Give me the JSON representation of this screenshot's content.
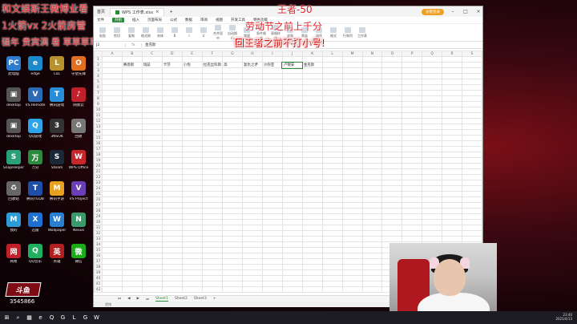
{
  "overlays": {
    "line1": "和文娱斯王微博业看",
    "line2": "1火箭vx 2火箭房管",
    "line3": "骚年 贵宾满 看 草草草草",
    "center_title": "王者-50",
    "center_line1": "劳动节之前上千分",
    "center_line2": "回王者之前不打小号!"
  },
  "desktop": {
    "icons": [
      {
        "label": "此电脑",
        "glyph": "PC",
        "color": "#2e7bcf"
      },
      {
        "label": "edge",
        "glyph": "e",
        "color": "#1a8acb"
      },
      {
        "label": "LoL",
        "glyph": "L",
        "color": "#b8922e"
      },
      {
        "label": "守望先锋",
        "glyph": "O",
        "color": "#e07020"
      },
      {
        "label": "desktop",
        "glyph": "▣",
        "color": "#555"
      },
      {
        "label": "VS Remote",
        "glyph": "V",
        "color": "#2c6ab3"
      },
      {
        "label": "腾讯游戏",
        "glyph": "T",
        "color": "#2a8dd8"
      },
      {
        "label": "网易云",
        "glyph": "♪",
        "color": "#c0202a"
      },
      {
        "label": "desktop",
        "glyph": "▣",
        "color": "#555"
      },
      {
        "label": "QQ游戏",
        "glyph": "Q",
        "color": "#2ea4e8"
      },
      {
        "label": "3NSOK",
        "glyph": "3",
        "color": "#333"
      },
      {
        "label": "回收",
        "glyph": "♻",
        "color": "#777"
      },
      {
        "label": "SnapHelper",
        "glyph": "S",
        "color": "#2aa07a"
      },
      {
        "label": "万分",
        "glyph": "万",
        "color": "#2b8a3e"
      },
      {
        "label": "Steam",
        "glyph": "S",
        "color": "#1b2838"
      },
      {
        "label": "WPS Office",
        "glyph": "W",
        "color": "#c7262a"
      },
      {
        "label": "回收站",
        "glyph": "♻",
        "color": "#666"
      },
      {
        "label": "腾讯TGDB",
        "glyph": "T",
        "color": "#1f4ea8"
      },
      {
        "label": "腾讯手游",
        "glyph": "M",
        "color": "#e8a020"
      },
      {
        "label": "VS Project",
        "glyph": "V",
        "color": "#6a3fb5"
      },
      {
        "label": "我的",
        "glyph": "M",
        "color": "#2e9bd6"
      },
      {
        "label": "迅雷",
        "glyph": "X",
        "color": "#1f6fd0"
      },
      {
        "label": "Wallpaper",
        "glyph": "W",
        "color": "#2a7fd0"
      },
      {
        "label": "Nexus",
        "glyph": "N",
        "color": "#3b9a6b"
      },
      {
        "label": "网易",
        "glyph": "网",
        "color": "#c0202a"
      },
      {
        "label": "QQ音乐",
        "glyph": "Q",
        "color": "#1eb060"
      },
      {
        "label": "英雄",
        "glyph": "英",
        "color": "#b02020"
      },
      {
        "label": "微信",
        "glyph": "微",
        "color": "#1aad19"
      }
    ]
  },
  "logo": {
    "text": "斗鱼",
    "room": "3545866"
  },
  "excel": {
    "titlebar": {
      "app_name": "首页",
      "file_name": "WPS 工作表.xlsx",
      "login_label": "访客登录"
    },
    "menu": [
      "文件",
      "开始",
      "插入",
      "页面布局",
      "公式",
      "数据",
      "审阅",
      "视图",
      "开发工具",
      "特色功能"
    ],
    "menu_active": "开始",
    "ribbon": [
      "粘贴",
      "剪切",
      "复制",
      "格式刷",
      "宋体",
      "B",
      "I",
      "U",
      "合并居中",
      "自动换行",
      "常规",
      "条件格式",
      "表格样式",
      "求和",
      "筛选",
      "排序",
      "格式",
      "行和列",
      "工作表"
    ],
    "formula_bar": {
      "cell_ref": "J2",
      "fx": "fx",
      "value": "金克斯"
    },
    "columns": [
      "A",
      "B",
      "C",
      "D",
      "E",
      "F",
      "G",
      "H",
      "I",
      "J",
      "K",
      "L",
      "M",
      "N",
      "O",
      "P",
      "Q",
      "R",
      "S"
    ],
    "row2": [
      "",
      "赛恩斯",
      "瑞兹",
      "卡莎",
      "小炮",
      "拉克丝科斯",
      "高",
      "复仇之矛",
      "沙弥亚",
      "卢锡安",
      "金克斯",
      "",
      "",
      "",
      "",
      "",
      "",
      "",
      ""
    ],
    "rows": 42,
    "sheets": [
      "Sheet1",
      "Sheet2",
      "Sheet3"
    ],
    "active_sheet": "Sheet1",
    "status": "就绪",
    "zoom": "100%"
  },
  "taskbar": {
    "time": "23:40",
    "date": "2021/4/13",
    "apps": [
      "⊞",
      "⌕",
      "▦",
      "e",
      "Q",
      "G",
      "L",
      "G",
      "W"
    ]
  }
}
